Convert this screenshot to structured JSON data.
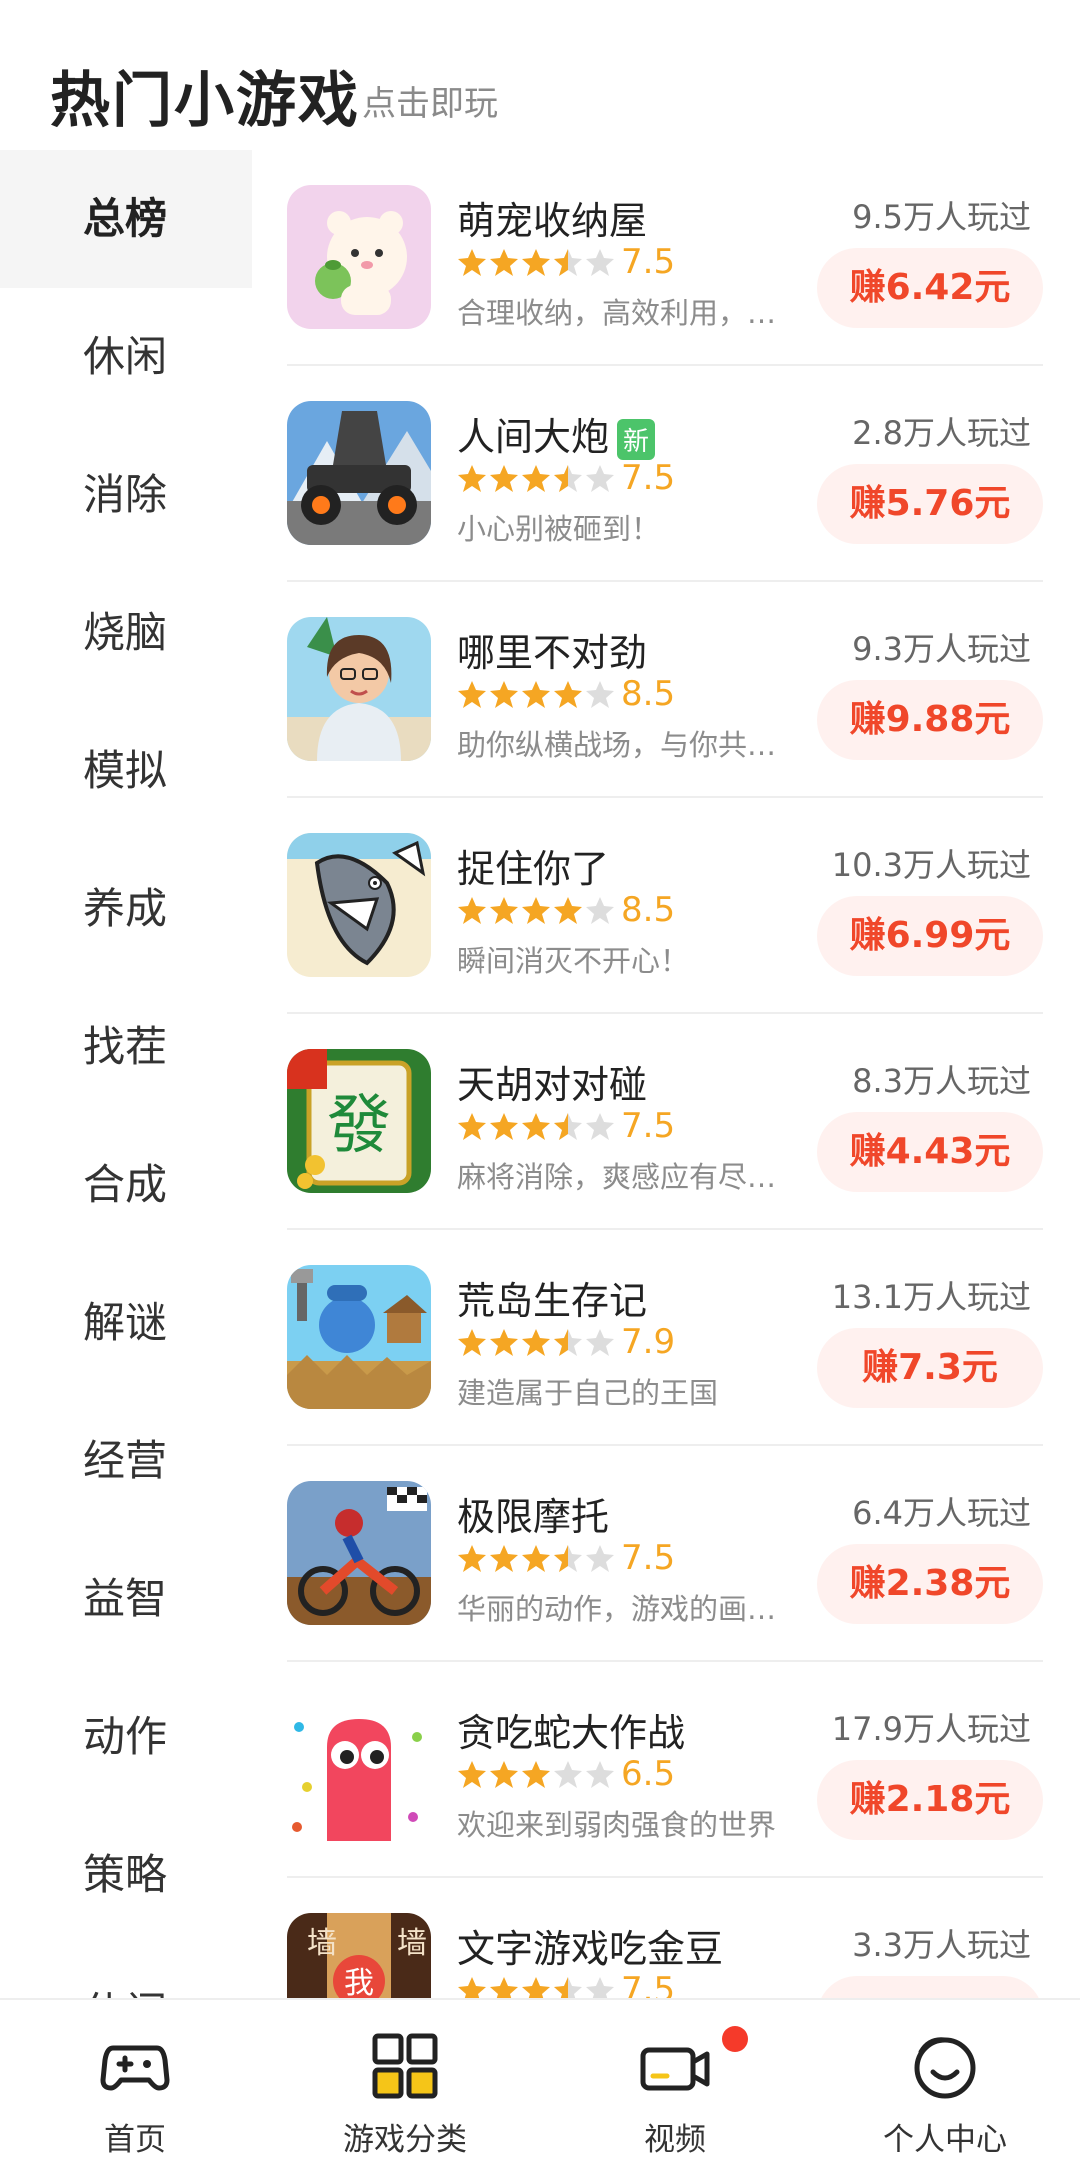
{
  "header": {
    "title": "热门小游戏",
    "subtitle": "点击即玩"
  },
  "sidebar": {
    "items": [
      {
        "label": "总榜",
        "active": true
      },
      {
        "label": "休闲"
      },
      {
        "label": "消除"
      },
      {
        "label": "烧脑"
      },
      {
        "label": "模拟"
      },
      {
        "label": "养成"
      },
      {
        "label": "找茬"
      },
      {
        "label": "合成"
      },
      {
        "label": "解谜"
      },
      {
        "label": "经营"
      },
      {
        "label": "益智"
      },
      {
        "label": "动作"
      },
      {
        "label": "策略"
      },
      {
        "label": "休闲"
      }
    ]
  },
  "games": [
    {
      "name": "萌宠收纳屋",
      "rating": 3.5,
      "score": "7.5",
      "desc": "合理收纳，高效利用，…",
      "plays": "9.5万人玩过",
      "earn": "赚6.42元",
      "icon": "pet-bear-icon"
    },
    {
      "name": "人间大炮",
      "badge": "新",
      "rating": 3.5,
      "score": "7.5",
      "desc": "小心别被砸到！",
      "plays": "2.8万人玩过",
      "earn": "赚5.76元",
      "icon": "cannon-icon"
    },
    {
      "name": "哪里不对劲",
      "rating": 4,
      "score": "8.5",
      "desc": "助你纵横战场，与你共…",
      "plays": "9.3万人玩过",
      "earn": "赚9.88元",
      "icon": "girl-portrait-icon"
    },
    {
      "name": "捉住你了",
      "rating": 4,
      "score": "8.5",
      "desc": "瞬间消灭不开心！",
      "plays": "10.3万人玩过",
      "earn": "赚6.99元",
      "icon": "shark-icon"
    },
    {
      "name": "天胡对对碰",
      "rating": 3.5,
      "score": "7.5",
      "desc": "麻将消除，爽感应有尽有！",
      "plays": "8.3万人玩过",
      "earn": "赚4.43元",
      "icon": "mahjong-tile-icon"
    },
    {
      "name": "荒岛生存记",
      "rating": 3.5,
      "score": "7.9",
      "desc": "建造属于自己的王国",
      "plays": "13.1万人玩过",
      "earn": "赚7.3元",
      "icon": "island-survivor-icon"
    },
    {
      "name": "极限摩托",
      "rating": 3.5,
      "score": "7.5",
      "desc": "华丽的动作，游戏的画…",
      "plays": "6.4万人玩过",
      "earn": "赚2.38元",
      "icon": "motocross-icon"
    },
    {
      "name": "贪吃蛇大作战",
      "rating": 3,
      "score": "6.5",
      "desc": "欢迎来到弱肉强食的世界",
      "plays": "17.9万人玩过",
      "earn": "赚2.18元",
      "icon": "snake-icon"
    },
    {
      "name": "文字游戏吃金豆",
      "rating": 3.5,
      "score": "7.5",
      "desc": "",
      "plays": "3.3万人玩过",
      "earn": "",
      "icon": "word-wall-icon"
    }
  ],
  "tabbar": {
    "items": [
      {
        "label": "首页",
        "icon": "gamepad-icon"
      },
      {
        "label": "游戏分类",
        "icon": "category-grid-icon"
      },
      {
        "label": "视频",
        "icon": "video-camera-icon",
        "dot": true
      },
      {
        "label": "个人中心",
        "icon": "smiley-profile-icon"
      }
    ]
  },
  "colors": {
    "accent": "#f0472a",
    "star": "#f5a623",
    "star_empty": "#dddddd",
    "earn_bg": "#fff1ef",
    "active_tab": "#f5c518"
  }
}
